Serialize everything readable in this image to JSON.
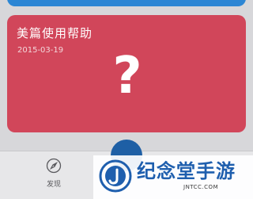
{
  "cards": {
    "help": {
      "title": "美篇使用帮助",
      "date": "2015-03-19",
      "question_mark": "?",
      "color": "#d1465a"
    },
    "blue_card_color": "#2c86d4"
  },
  "tabbar": {
    "discover": {
      "label": "发现",
      "icon": "compass-icon"
    },
    "center_button_icon": "add-icon"
  },
  "watermark": {
    "name": "纪念堂手游",
    "domain": "JNTCC.COM",
    "color": "#1f5fae"
  }
}
